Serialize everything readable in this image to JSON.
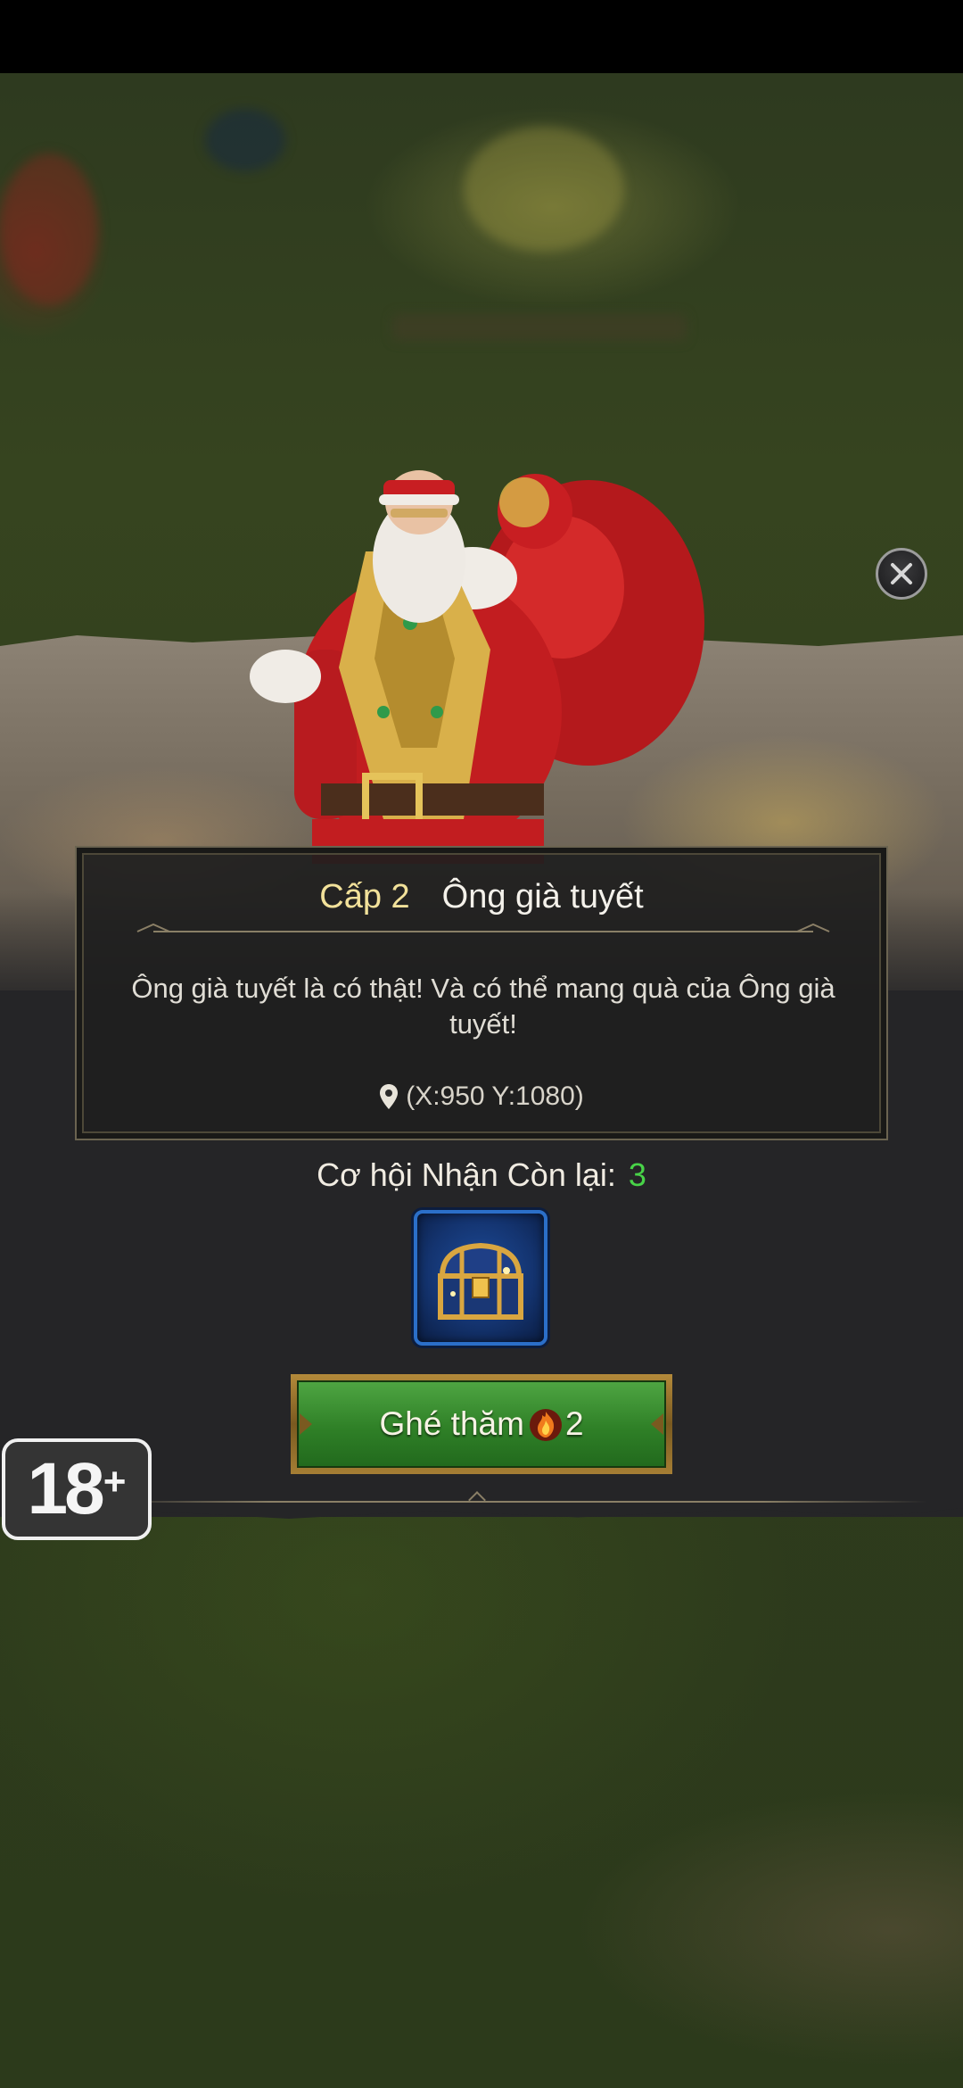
{
  "popup": {
    "level_label": "Cấp 2",
    "name": "Ông già tuyết",
    "description": "Ông già tuyết là có thật! Và có thể mang quà của Ông già tuyết!",
    "coordinates": "(X:950 Y:1080)"
  },
  "reward": {
    "chance_label": "Cơ hội Nhận Còn lại:",
    "chance_count": "3",
    "item_icon": "treasure-chest-icon"
  },
  "visit_button": {
    "label": "Ghé thăm",
    "cost_icon": "fire-icon",
    "cost": "2"
  },
  "age_rating": {
    "number": "18",
    "plus": "+"
  },
  "close_icon": "close-icon",
  "colors": {
    "level_text": "#f2e19a",
    "count_text": "#48d348",
    "button_green": "#2f8027",
    "frame_gold": "#b48a3a"
  }
}
